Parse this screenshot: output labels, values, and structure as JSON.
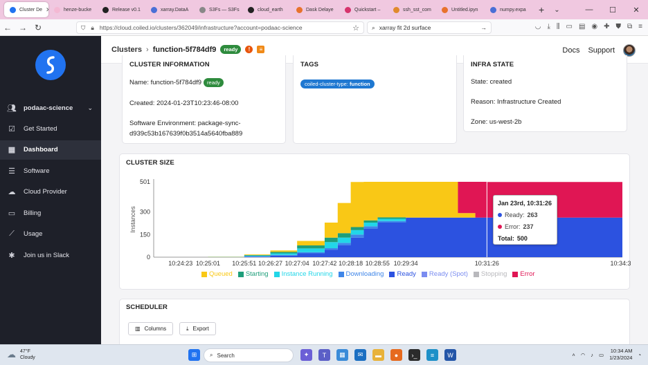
{
  "browser": {
    "tabs": [
      {
        "label": "Cluster De",
        "color": "#2173f0",
        "active": true
      },
      {
        "label": "henze-bucke",
        "color": "#f4b9d3"
      },
      {
        "label": "Release v0.1",
        "color": "#222222"
      },
      {
        "label": "xarray.DataA",
        "color": "#4a6fd6"
      },
      {
        "label": "S3Fs — S3Fs",
        "color": "#888888"
      },
      {
        "label": "cloud_earth",
        "color": "#222222"
      },
      {
        "label": "Dask Delaye",
        "color": "#e8722c"
      },
      {
        "label": "Quickstart –",
        "color": "#d6336c"
      },
      {
        "label": "ssh_sst_com",
        "color": "#e08a2c"
      },
      {
        "label": "Untitled.ipyn",
        "color": "#e8722c"
      },
      {
        "label": "numpy.expa",
        "color": "#4a6fd6"
      }
    ],
    "new_tab": "+",
    "url": "https://cloud.coiled.io/clusters/362049/infrastructure?account=podaac-science",
    "search_text": "xarray fit 2d surface"
  },
  "sidebar": {
    "account": "podaac-science",
    "items": [
      {
        "label": "Get Started",
        "icon": "checklist-icon"
      },
      {
        "label": "Dashboard",
        "icon": "grid-icon",
        "active": true
      },
      {
        "label": "Software",
        "icon": "sliders-icon"
      },
      {
        "label": "Cloud Provider",
        "icon": "cloud-icon"
      },
      {
        "label": "Billing",
        "icon": "card-icon"
      },
      {
        "label": "Usage",
        "icon": "trend-icon"
      },
      {
        "label": "Join us in Slack",
        "icon": "slack-icon"
      }
    ]
  },
  "header": {
    "crumb_root": "Clusters",
    "separator": "›",
    "cluster_name": "function-5f784df9",
    "status": "ready",
    "docs": "Docs",
    "support": "Support"
  },
  "cluster_info": {
    "title": "CLUSTER INFORMATION",
    "name_label": "Name: function-5f784df9",
    "status": "ready",
    "created": "Created: 2024-01-23T10:23:46-08:00",
    "software_1": "Software Environment: package-sync-",
    "software_2": "d939c53b167639f0b3514a5640fba889"
  },
  "tags": {
    "title": "TAGS",
    "tag_key": "coiled-cluster-type:",
    "tag_value": "function"
  },
  "infra_state": {
    "title": "INFRA STATE",
    "state": "State: created",
    "reason": "Reason: Infrastructure Created",
    "zone": "Zone: us-west-2b"
  },
  "chart_data": {
    "type": "area",
    "title": "CLUSTER SIZE",
    "xlabel": "",
    "ylabel": "Instances",
    "ylim": [
      0,
      501
    ],
    "yticks": [
      0,
      150,
      300,
      501
    ],
    "xticks": [
      "10:24:23",
      "10:25:01",
      "10:25:51",
      "10:26:27",
      "10:27:04",
      "10:27:42",
      "10:28:18",
      "10:28:55",
      "10:29:34",
      "10:31:26",
      "10:34:33"
    ],
    "x": [
      "10:23:46",
      "10:24:23",
      "10:25:01",
      "10:25:51",
      "10:26:27",
      "10:27:04",
      "10:27:42",
      "10:28:00",
      "10:28:18",
      "10:28:36",
      "10:28:55",
      "10:29:34",
      "10:30:10",
      "10:30:46",
      "10:31:10",
      "10:31:26",
      "10:32:30",
      "10:33:30",
      "10:34:33"
    ],
    "series": [
      {
        "name": "Ready",
        "color": "#2c52e0",
        "values": [
          0,
          0,
          0,
          4,
          10,
          25,
          50,
          80,
          130,
          190,
          230,
          263,
          263,
          263,
          263,
          263,
          263,
          263,
          263
        ]
      },
      {
        "name": "Downloading",
        "color": "#3f86e8",
        "values": [
          0,
          0,
          0,
          2,
          5,
          8,
          10,
          15,
          20,
          15,
          10,
          0,
          0,
          0,
          0,
          0,
          0,
          0,
          0
        ]
      },
      {
        "name": "Instance Running",
        "color": "#22d6e8",
        "values": [
          0,
          0,
          1,
          4,
          10,
          25,
          40,
          35,
          30,
          25,
          15,
          0,
          0,
          0,
          0,
          0,
          0,
          0,
          0
        ]
      },
      {
        "name": "Starting",
        "color": "#1e9e7a",
        "values": [
          0,
          0,
          1,
          4,
          10,
          20,
          30,
          30,
          20,
          15,
          10,
          0,
          0,
          0,
          0,
          0,
          0,
          0,
          0
        ]
      },
      {
        "name": "Queued",
        "color": "#f9c816",
        "values": [
          0,
          0,
          1,
          4,
          10,
          30,
          100,
          200,
          300,
          256,
          236,
          238,
          238,
          30,
          0,
          0,
          0,
          0,
          0
        ]
      },
      {
        "name": "Error",
        "color": "#e01654",
        "values": [
          0,
          0,
          0,
          0,
          0,
          0,
          0,
          0,
          0,
          0,
          0,
          0,
          0,
          208,
          238,
          237,
          237,
          237,
          237
        ]
      }
    ],
    "legend": [
      {
        "name": "Queued",
        "color": "#f9c816"
      },
      {
        "name": "Starting",
        "color": "#1e9e7a"
      },
      {
        "name": "Instance Running",
        "color": "#22d6e8"
      },
      {
        "name": "Downloading",
        "color": "#3f86e8"
      },
      {
        "name": "Ready",
        "color": "#2c52e0"
      },
      {
        "name": "Ready (Spot)",
        "color": "#7a8cf0"
      },
      {
        "name": "Stopping",
        "color": "#b8b8bc"
      },
      {
        "name": "Error",
        "color": "#e01654"
      }
    ],
    "tooltip": {
      "title": "Jan 23rd, 10:31:26",
      "ready_label": "Ready:",
      "ready_value": "263",
      "error_label": "Error:",
      "error_value": "237",
      "total_label": "Total:",
      "total_value": "500"
    }
  },
  "scheduler": {
    "title": "SCHEDULER",
    "columns_button": "Columns",
    "export_button": "Export"
  },
  "taskbar": {
    "temp": "47°F",
    "weather": "Cloudy",
    "search": "Search",
    "time": "10:34 AM",
    "date": "1/23/2024"
  }
}
